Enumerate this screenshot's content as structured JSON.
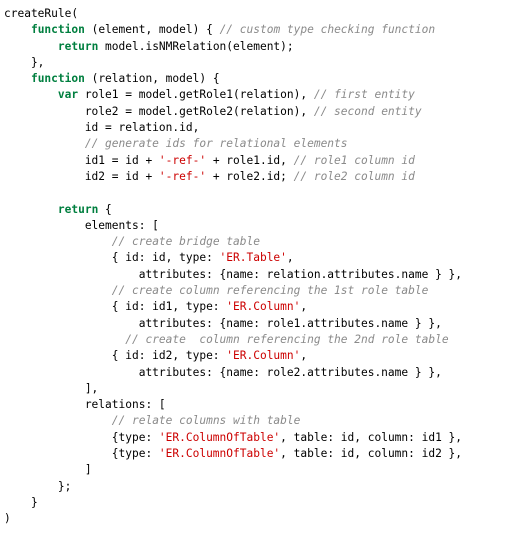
{
  "document": {
    "title": "createRule(",
    "language": "javascript",
    "theme": {
      "background": "#ffffff",
      "text": "#000000",
      "keyword": "#007f3f",
      "comment": "#8a8a8a",
      "string": "#cc0000"
    },
    "lines": [
      [
        {
          "t": "plain",
          "v": "createRule("
        }
      ],
      [
        {
          "t": "plain",
          "v": "    "
        },
        {
          "t": "keyword",
          "v": "function"
        },
        {
          "t": "plain",
          "v": " (element, model) { "
        },
        {
          "t": "comment",
          "v": "// custom type checking function"
        }
      ],
      [
        {
          "t": "plain",
          "v": "        "
        },
        {
          "t": "keyword",
          "v": "return"
        },
        {
          "t": "plain",
          "v": " model.isNMRelation(element);"
        }
      ],
      [
        {
          "t": "plain",
          "v": "    },"
        }
      ],
      [
        {
          "t": "plain",
          "v": "    "
        },
        {
          "t": "keyword",
          "v": "function"
        },
        {
          "t": "plain",
          "v": " (relation, model) {"
        }
      ],
      [
        {
          "t": "plain",
          "v": "        "
        },
        {
          "t": "keyword",
          "v": "var"
        },
        {
          "t": "plain",
          "v": " role1 = model.getRole1(relation), "
        },
        {
          "t": "comment",
          "v": "// first entity"
        }
      ],
      [
        {
          "t": "plain",
          "v": "            role2 = model.getRole2(relation), "
        },
        {
          "t": "comment",
          "v": "// second entity"
        }
      ],
      [
        {
          "t": "plain",
          "v": "            id = relation.id,"
        }
      ],
      [
        {
          "t": "plain",
          "v": "            "
        },
        {
          "t": "comment",
          "v": "// generate ids for relational elements"
        }
      ],
      [
        {
          "t": "plain",
          "v": "            id1 = id + "
        },
        {
          "t": "string",
          "v": "'-ref-'"
        },
        {
          "t": "plain",
          "v": " + role1.id, "
        },
        {
          "t": "comment",
          "v": "// role1 column id"
        }
      ],
      [
        {
          "t": "plain",
          "v": "            id2 = id + "
        },
        {
          "t": "string",
          "v": "'-ref-'"
        },
        {
          "t": "plain",
          "v": " + role2.id; "
        },
        {
          "t": "comment",
          "v": "// role2 column id"
        }
      ],
      [
        {
          "t": "plain",
          "v": ""
        }
      ],
      [
        {
          "t": "plain",
          "v": "        "
        },
        {
          "t": "keyword",
          "v": "return"
        },
        {
          "t": "plain",
          "v": " {"
        }
      ],
      [
        {
          "t": "plain",
          "v": "            elements: ["
        }
      ],
      [
        {
          "t": "plain",
          "v": "                "
        },
        {
          "t": "comment",
          "v": "// create bridge table"
        }
      ],
      [
        {
          "t": "plain",
          "v": "                { id: id, type: "
        },
        {
          "t": "string",
          "v": "'ER.Table'"
        },
        {
          "t": "plain",
          "v": ","
        }
      ],
      [
        {
          "t": "plain",
          "v": "                    attributes: {name: relation.attributes.name } },"
        }
      ],
      [
        {
          "t": "plain",
          "v": "                "
        },
        {
          "t": "comment",
          "v": "// create column referencing the 1st role table"
        }
      ],
      [
        {
          "t": "plain",
          "v": "                { id: id1, type: "
        },
        {
          "t": "string",
          "v": "'ER.Column'"
        },
        {
          "t": "plain",
          "v": ","
        }
      ],
      [
        {
          "t": "plain",
          "v": "                    attributes: {name: role1.attributes.name } },"
        }
      ],
      [
        {
          "t": "plain",
          "v": "                  "
        },
        {
          "t": "comment",
          "v": "// create  column referencing the 2nd role table"
        }
      ],
      [
        {
          "t": "plain",
          "v": "                { id: id2, type: "
        },
        {
          "t": "string",
          "v": "'ER.Column'"
        },
        {
          "t": "plain",
          "v": ","
        }
      ],
      [
        {
          "t": "plain",
          "v": "                    attributes: {name: role2.attributes.name } },"
        }
      ],
      [
        {
          "t": "plain",
          "v": "            ],"
        }
      ],
      [
        {
          "t": "plain",
          "v": "            relations: ["
        }
      ],
      [
        {
          "t": "plain",
          "v": "                "
        },
        {
          "t": "comment",
          "v": "// relate columns with table"
        }
      ],
      [
        {
          "t": "plain",
          "v": "                {type: "
        },
        {
          "t": "string",
          "v": "'ER.ColumnOfTable'"
        },
        {
          "t": "plain",
          "v": ", table: id, column: id1 },"
        }
      ],
      [
        {
          "t": "plain",
          "v": "                {type: "
        },
        {
          "t": "string",
          "v": "'ER.ColumnOfTable'"
        },
        {
          "t": "plain",
          "v": ", table: id, column: id2 },"
        }
      ],
      [
        {
          "t": "plain",
          "v": "            ]"
        }
      ],
      [
        {
          "t": "plain",
          "v": "        };"
        }
      ],
      [
        {
          "t": "plain",
          "v": "    }"
        }
      ],
      [
        {
          "t": "plain",
          "v": ")"
        }
      ]
    ]
  }
}
